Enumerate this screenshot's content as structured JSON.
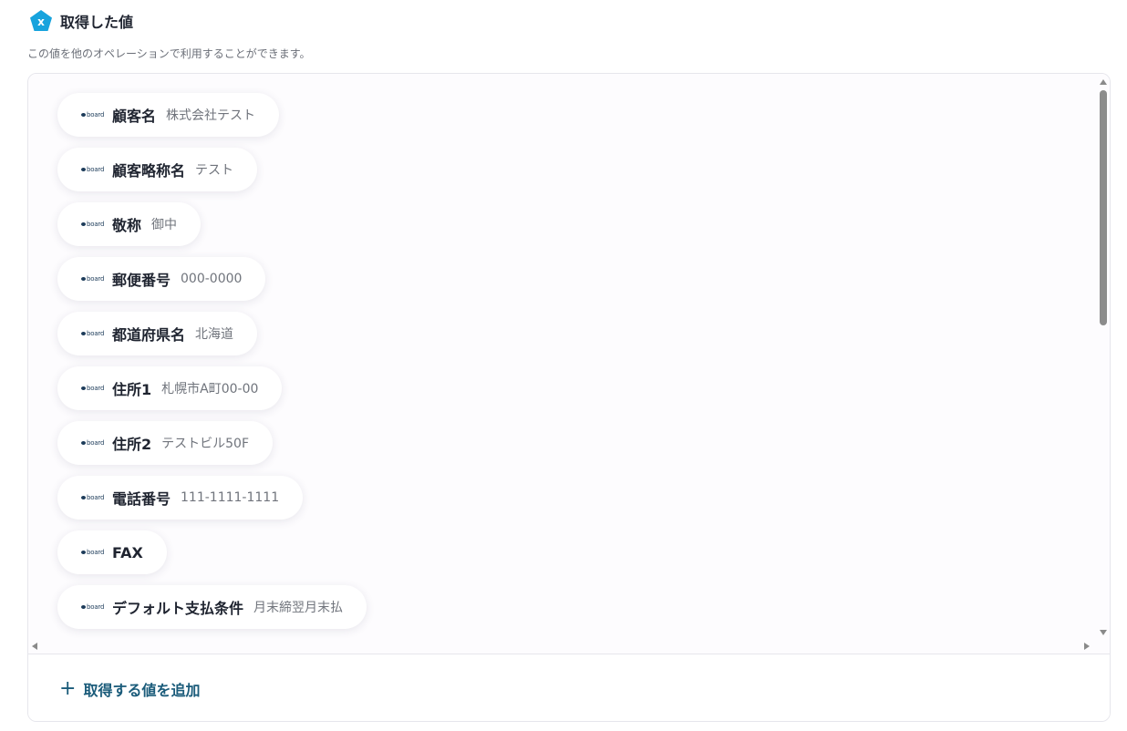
{
  "header": {
    "title": "取得した値",
    "icon": "x-pentagon-icon"
  },
  "description": "この値を他のオペレーションで利用することができます。",
  "logo_text": "board",
  "items": [
    {
      "label": "顧客名",
      "value": "株式会社テスト"
    },
    {
      "label": "顧客略称名",
      "value": "テスト"
    },
    {
      "label": "敬称",
      "value": "御中"
    },
    {
      "label": "郵便番号",
      "value": "000-0000"
    },
    {
      "label": "都道府県名",
      "value": "北海道"
    },
    {
      "label": "住所1",
      "value": "札幌市A町00-00"
    },
    {
      "label": "住所2",
      "value": "テストビル50F"
    },
    {
      "label": "電話番号",
      "value": "111-1111-1111"
    },
    {
      "label": "FAX",
      "value": ""
    },
    {
      "label": "デフォルト支払条件",
      "value": "月末締翌月末払"
    }
  ],
  "footer": {
    "add_label": "取得する値を追加",
    "add_icon": "plus-icon"
  },
  "colors": {
    "accent": "#1a5b7a",
    "icon_blue": "#17a3dd"
  }
}
